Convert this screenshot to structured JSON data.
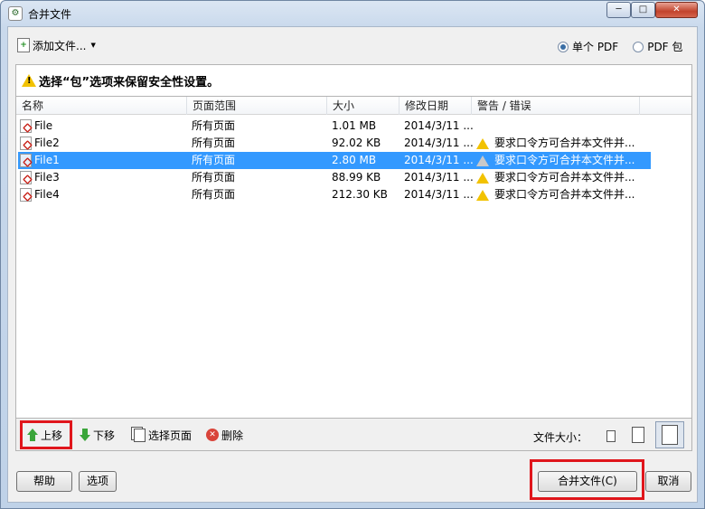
{
  "window": {
    "title": "合并文件",
    "minimize": "─",
    "maximize": "□",
    "close": "✕"
  },
  "toolbar": {
    "add_files_label": "添加文件...",
    "radio_single_pdf": "单个 PDF",
    "radio_pdf_package": "PDF 包",
    "single_pdf_selected": true
  },
  "banner": {
    "text": "选择“包”选项来保留安全性设置。"
  },
  "columns": [
    "名称",
    "页面范围",
    "大小",
    "修改日期",
    "警告 / 错误"
  ],
  "files": [
    {
      "name": "File",
      "range": "所有页面",
      "size": "1.01 MB",
      "date": "2014/3/11 ...",
      "warning": ""
    },
    {
      "name": "File2",
      "range": "所有页面",
      "size": "92.02 KB",
      "date": "2014/3/11 ...",
      "warning": "要求口令方可合并本文件并..."
    },
    {
      "name": "File1",
      "range": "所有页面",
      "size": "2.80 MB",
      "date": "2014/3/11 ...",
      "warning": "要求口令方可合并本文件并...",
      "selected": true
    },
    {
      "name": "File3",
      "range": "所有页面",
      "size": "88.99 KB",
      "date": "2014/3/11 ...",
      "warning": "要求口令方可合并本文件并..."
    },
    {
      "name": "File4",
      "range": "所有页面",
      "size": "212.30 KB",
      "date": "2014/3/11 ...",
      "warning": "要求口令方可合并本文件并..."
    }
  ],
  "actions": {
    "move_up": "上移",
    "move_down": "下移",
    "choose_pages": "选择页面",
    "remove": "删除",
    "file_size_label": "文件大小："
  },
  "buttons": {
    "help": "帮助",
    "options": "选项",
    "combine": "合并文件(C)",
    "cancel": "取消"
  },
  "colors": {
    "selection": "#3399ff",
    "highlight_box": "#e0161c",
    "warning": "#f2c200"
  }
}
